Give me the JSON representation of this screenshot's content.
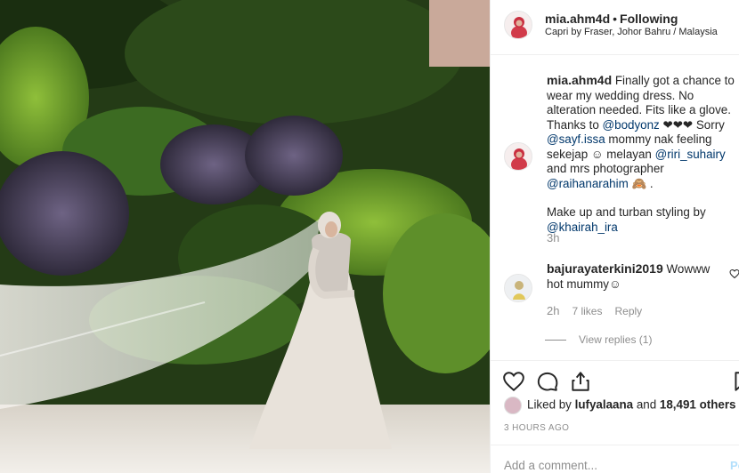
{
  "post": {
    "username": "mia.ahm4d",
    "separator": "•",
    "follow_status": "Following",
    "location": "Capri by Fraser, Johor Bahru / Malaysia"
  },
  "caption": {
    "username": "mia.ahm4d",
    "text1": " Finally got a chance to wear my wedding dress. No alteration needed. Fits like a glove. Thanks to ",
    "mention1": "@bodyonz",
    "text2": " ❤︎❤︎❤︎ Sorry ",
    "mention2": "@sayf.issa",
    "text3": " mommy nak feeling sekejap ☺ melayan ",
    "mention3": "@riri_suhairy",
    "text4": " and mrs photographer ",
    "mention4": "@raihanarahim",
    "text5": " 🙈 .",
    "text6": "Make up and turban styling by ",
    "mention5": "@khairah_ira",
    "time": "3h"
  },
  "comment": {
    "username": "bajurayaterkini2019",
    "text": " Wowww hot mummy☺",
    "time": "2h",
    "likes": "7 likes",
    "reply": "Reply",
    "view_replies": "View replies (1)"
  },
  "likes": {
    "prefix": "Liked by ",
    "user": "lufyalaana",
    "middle": " and ",
    "count": "18,491 others"
  },
  "posted": "3 HOURS AGO",
  "add_comment": {
    "placeholder": "Add a comment...",
    "post": "Po"
  },
  "icons": [
    "heart-icon",
    "comment-icon",
    "share-icon",
    "bookmark-icon"
  ],
  "colors": {
    "mention": "#00376b",
    "muted": "#8e8e8e",
    "post_disabled": "#b2dffc"
  }
}
